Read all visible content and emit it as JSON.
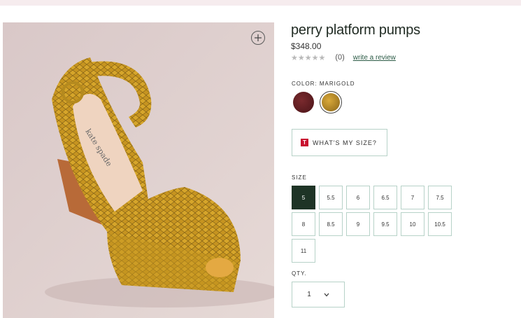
{
  "product": {
    "title": "perry platform pumps",
    "price": "$348.00",
    "rating_stars": "★★★★★",
    "review_count": "(0)",
    "write_review": "write a review"
  },
  "color": {
    "label": "COLOR: MARIGOLD",
    "swatches": [
      {
        "name": "oxblood",
        "color": "#5a1a1e"
      },
      {
        "name": "marigold",
        "color": "#c79a2a",
        "selected": true
      }
    ]
  },
  "size_guide": {
    "icon_letter": "T",
    "label": "WHAT'S MY SIZE?"
  },
  "sizes": {
    "label": "SIZE",
    "options": [
      "5",
      "5.5",
      "6",
      "6.5",
      "7",
      "7.5",
      "8",
      "8.5",
      "9",
      "9.5",
      "10",
      "10.5",
      "11"
    ],
    "selected": "5"
  },
  "quantity": {
    "label": "QTY.",
    "value": "1"
  },
  "colors": {
    "accent": "#1e3426",
    "border": "#b7d2c8",
    "link": "#2c5b46"
  }
}
